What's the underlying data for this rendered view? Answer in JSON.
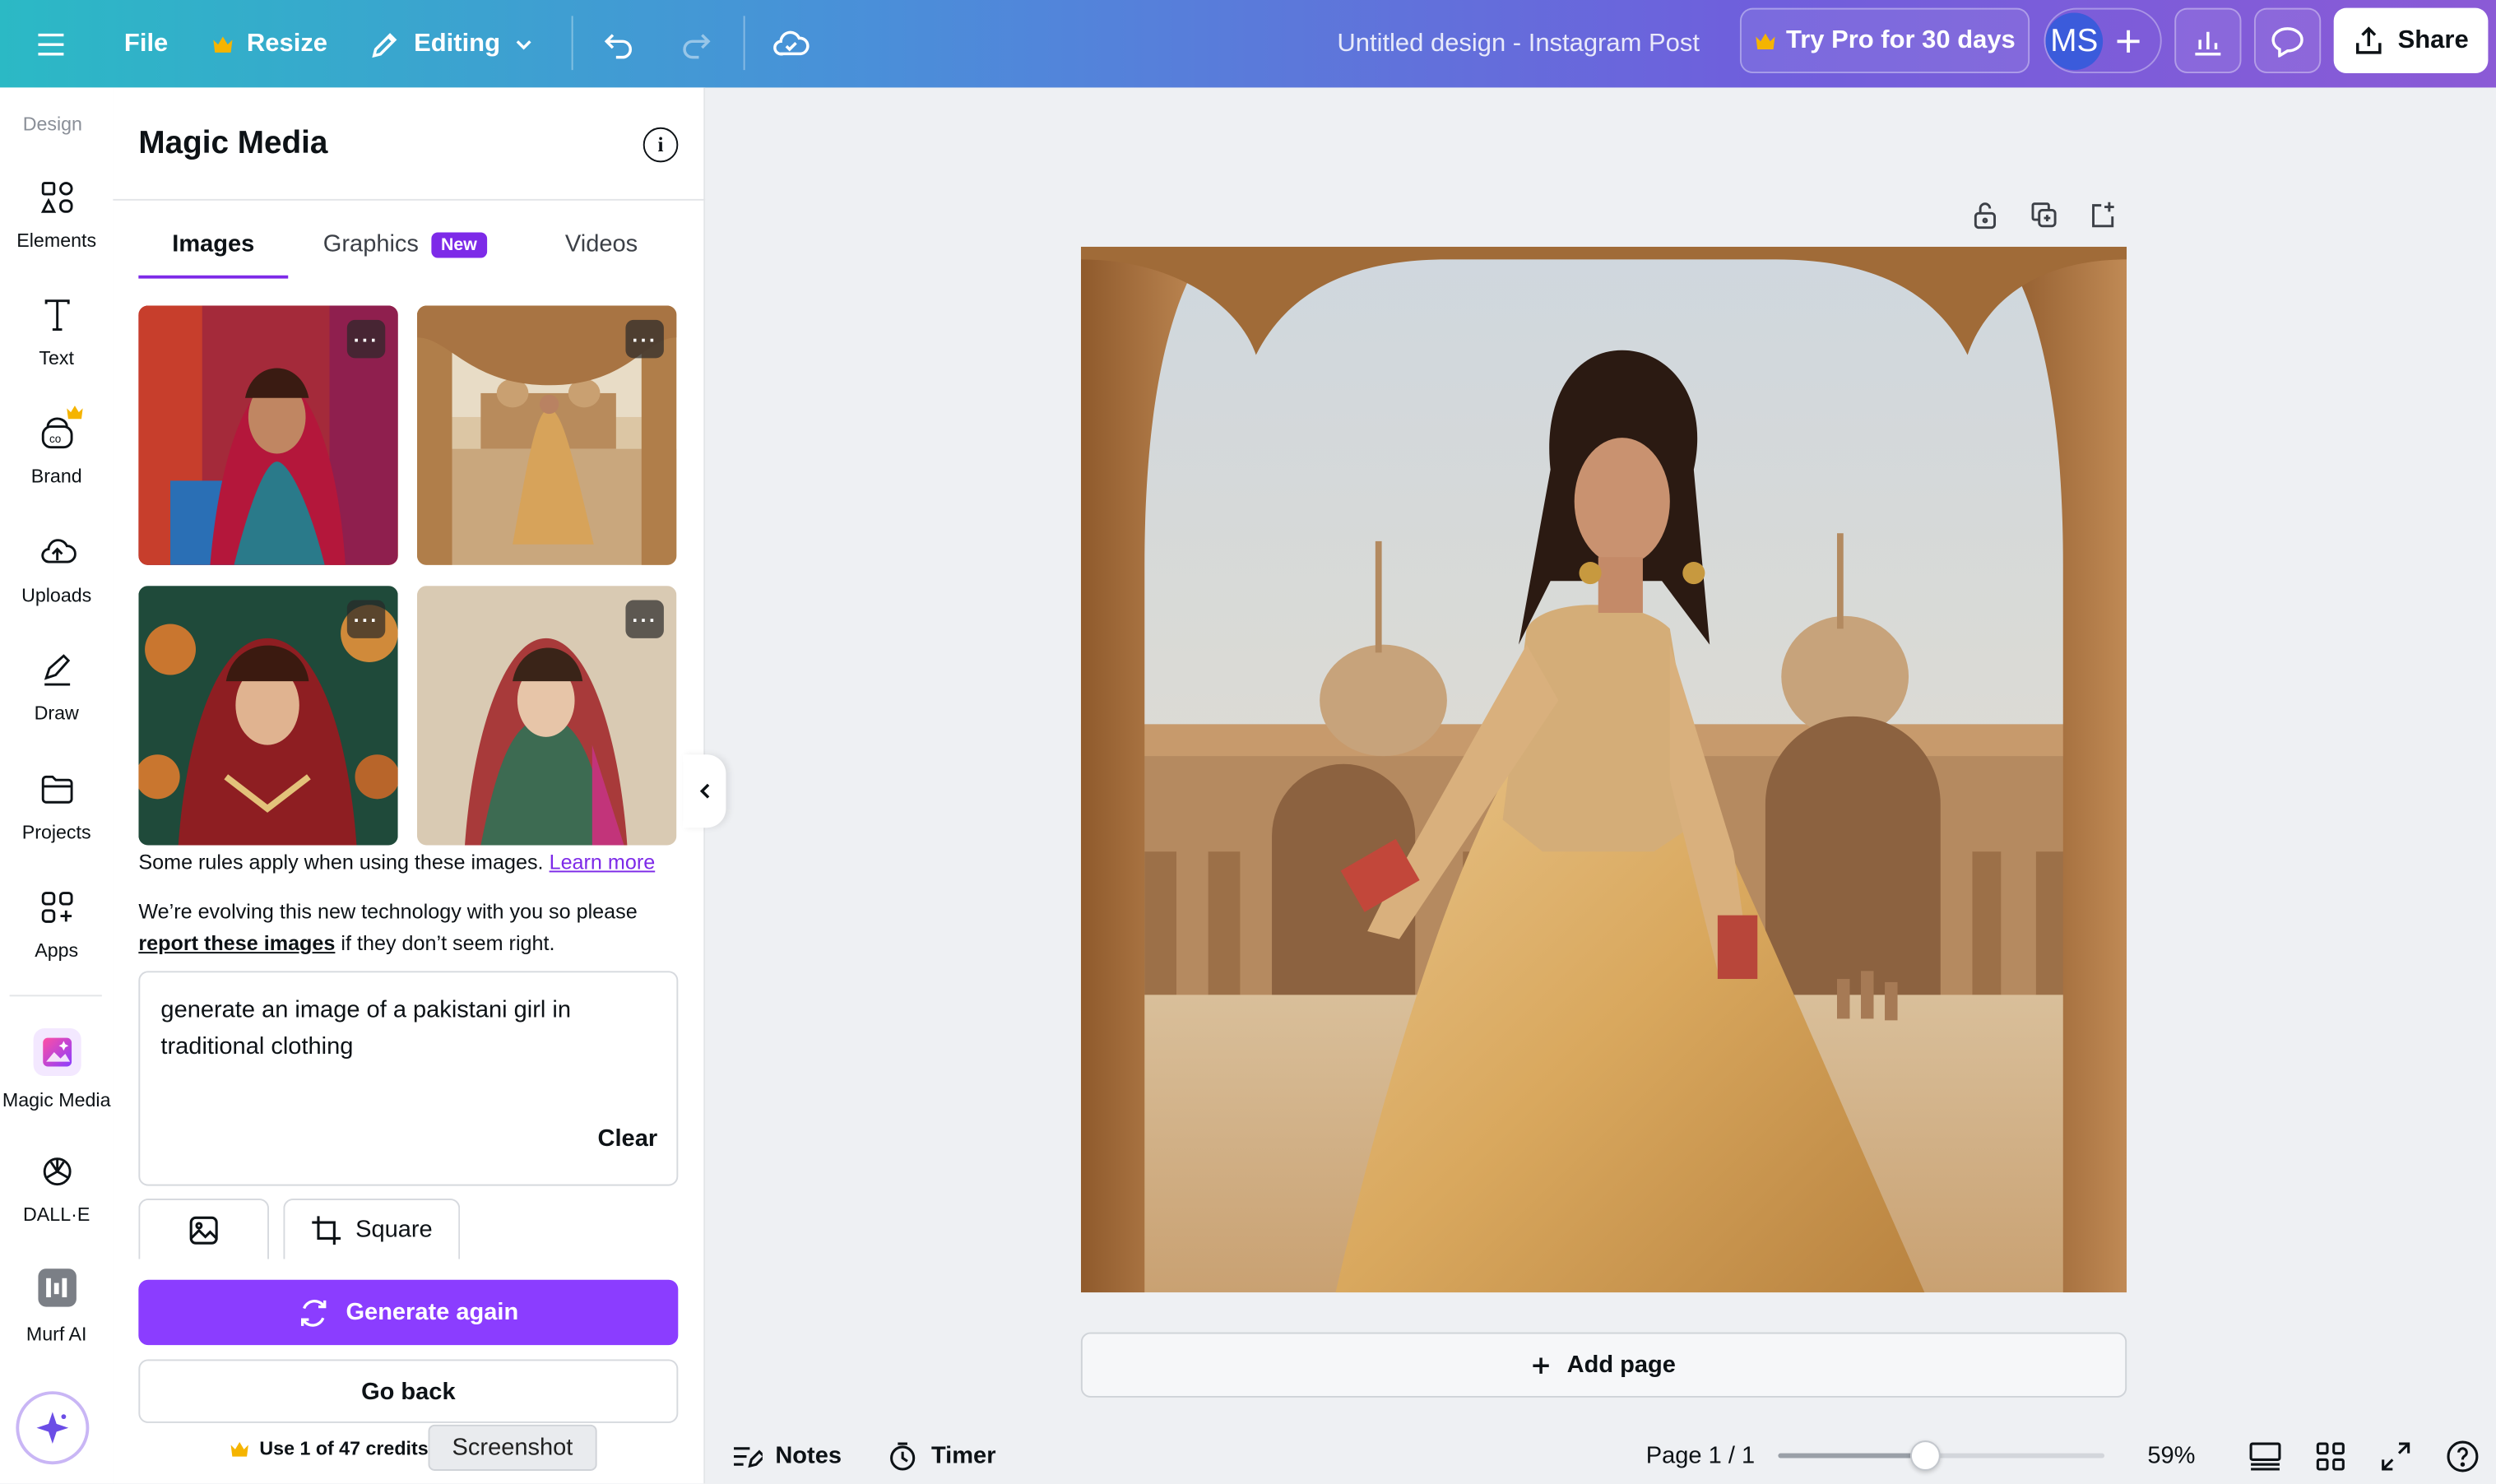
{
  "topbar": {
    "menu_icon": "hamburger-icon",
    "file_label": "File",
    "resize_label": "Resize",
    "editing_label": "Editing",
    "doc_title": "Untitled design - Instagram Post",
    "try_pro_label": "Try Pro for 30 days",
    "avatar_initials": "MS",
    "share_label": "Share",
    "crown_color": "#f5b400",
    "avatar_color": "#3b5bdb"
  },
  "sidebar": {
    "design_label": "Design",
    "items": [
      {
        "label": "Elements",
        "icon": "elements-icon"
      },
      {
        "label": "Text",
        "icon": "text-icon"
      },
      {
        "label": "Brand",
        "icon": "brand-icon"
      },
      {
        "label": "Uploads",
        "icon": "cloud-upload-icon"
      },
      {
        "label": "Draw",
        "icon": "pen-icon"
      },
      {
        "label": "Projects",
        "icon": "folder-icon"
      },
      {
        "label": "Apps",
        "icon": "apps-icon"
      },
      {
        "label": "Magic Media",
        "icon": "magic-media-icon"
      },
      {
        "label": "DALL·E",
        "icon": "openai-icon"
      },
      {
        "label": "Murf AI",
        "icon": "murf-icon"
      }
    ]
  },
  "panel": {
    "title": "Magic Media",
    "tabs": [
      {
        "label": "Images",
        "active": true
      },
      {
        "label": "Graphics",
        "badge": "New"
      },
      {
        "label": "Videos"
      }
    ],
    "rules_text": "Some rules apply when using these images.",
    "learn_more": "Learn more",
    "evolving_text": "We’re evolving this new technology with you so please",
    "report_link": "report these images",
    "report_suffix": "if they don’t seem right.",
    "prompt": "generate an image of a pakistani girl in traditional clothing",
    "clear_label": "Clear",
    "aspect_label": "Square",
    "generate_label": "Generate again",
    "go_back_label": "Go back",
    "credits_text": "Use 1 of 47 credits.",
    "tooltip": "Screenshot",
    "accent": "#7d2ae8"
  },
  "canvas": {
    "add_page_label": "Add page"
  },
  "bottombar": {
    "notes_label": "Notes",
    "timer_label": "Timer",
    "page_label": "Page 1 / 1",
    "zoom_label": "59%",
    "zoom_fraction": 0.45
  }
}
